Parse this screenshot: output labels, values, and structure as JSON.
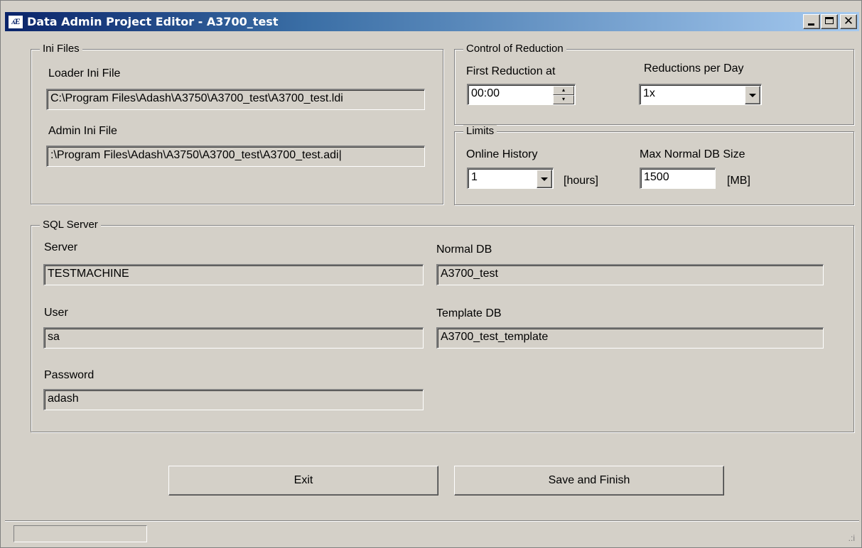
{
  "window": {
    "title": "Data Admin Project Editor - A3700_test",
    "icon_text": "ʎE"
  },
  "ini_files": {
    "legend": "Ini Files",
    "loader_label": "Loader Ini File",
    "loader_value": "C:\\Program Files\\Adash\\A3750\\A3700_test\\A3700_test.ldi",
    "admin_label": "Admin Ini File",
    "admin_value": ":\\Program Files\\Adash\\A3750\\A3700_test\\A3700_test.adi|"
  },
  "control_of_reduction": {
    "legend": "Control of Reduction",
    "first_reduction_label": "First Reduction at",
    "first_reduction_value": "00:00",
    "reductions_per_day_label": "Reductions per Day",
    "reductions_per_day_value": "1x"
  },
  "limits": {
    "legend": "Limits",
    "online_history_label": "Online History",
    "online_history_value": "1",
    "online_history_unit": "[hours]",
    "max_db_size_label": "Max Normal DB Size",
    "max_db_size_value": "1500",
    "max_db_size_unit": "[MB]"
  },
  "sql_server": {
    "legend": "SQL Server",
    "server_label": "Server",
    "server_value": "TESTMACHINE",
    "user_label": "User",
    "user_value": "sa",
    "password_label": "Password",
    "password_value": "adash",
    "normal_db_label": "Normal DB",
    "normal_db_value": "A3700_test",
    "template_db_label": "Template DB",
    "template_db_value": "A3700_test_template"
  },
  "buttons": {
    "exit_label": "Exit",
    "save_label": "Save and Finish"
  },
  "statusbar": {
    "panel_text": "",
    "grip": ".:i"
  }
}
